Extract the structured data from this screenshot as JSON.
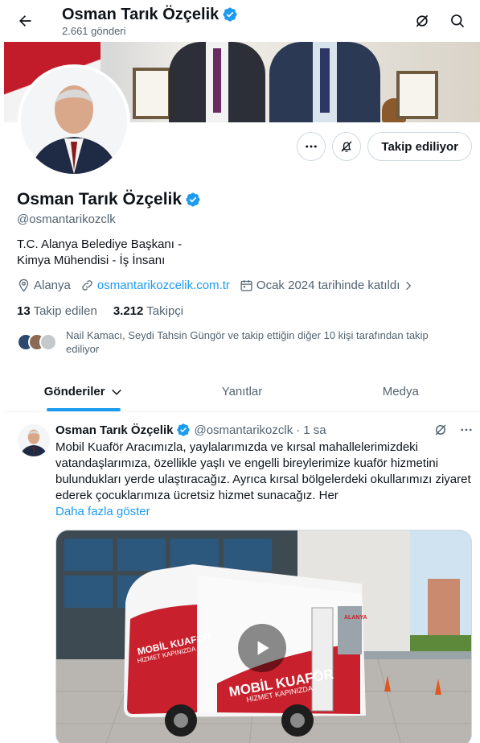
{
  "header": {
    "title": "Osman Tarık Özçelik",
    "post_count": "2.661 gönderi"
  },
  "profile": {
    "name": "Osman Tarık Özçelik",
    "handle": "@osmantarikozclk",
    "bio_line1": "T.C. Alanya Belediye Başkanı -",
    "bio_line2": "Kimya Mühendisi - İş İnsanı",
    "location": "Alanya",
    "website": "osmantarikozcelik.com.tr",
    "joined": "Ocak 2024 tarihinde katıldı",
    "following_count": "13",
    "following_label": "Takip edilen",
    "followers_count": "3.212",
    "followers_label": "Takipçi",
    "mutuals_text": "Nail Kamacı, Seydi Tahsin Güngör ve takip ettiğin diğer 10 kişi tarafından takip ediliyor",
    "follow_button": "Takip ediliyor"
  },
  "tabs": [
    {
      "label": "Gönderiler",
      "active": true
    },
    {
      "label": "Yanıtlar",
      "active": false
    },
    {
      "label": "Medya",
      "active": false
    }
  ],
  "tweet": {
    "name": "Osman Tarık Özçelik",
    "handle": "@osmantarikozclk",
    "separator": "·",
    "time": "1 sa",
    "text": "Mobil Kuaför Aracımızla, yaylalarımızda ve kırsal mahallelerimizdeki vatandaşlarımıza, özellikle yaşlı ve engelli bireylerimize kuaför hizmetini bulundukları yerde ulaştıracağız. Ayrıca kırsal bölgelerdeki okullarımızı ziyaret ederek çocuklarımıza ücretsiz hizmet sunacağız. Her",
    "show_more": "Daha fazla göster",
    "media": {
      "trailer_brand": "MOBİL KUAFÖR",
      "trailer_tagline": "HİZMET KAPINIZDA",
      "trailer_city": "ALANYA"
    }
  },
  "colors": {
    "accent": "#1d9bf0",
    "text": "#0f1419",
    "muted": "#536471",
    "verified": "#1d9bf0"
  }
}
